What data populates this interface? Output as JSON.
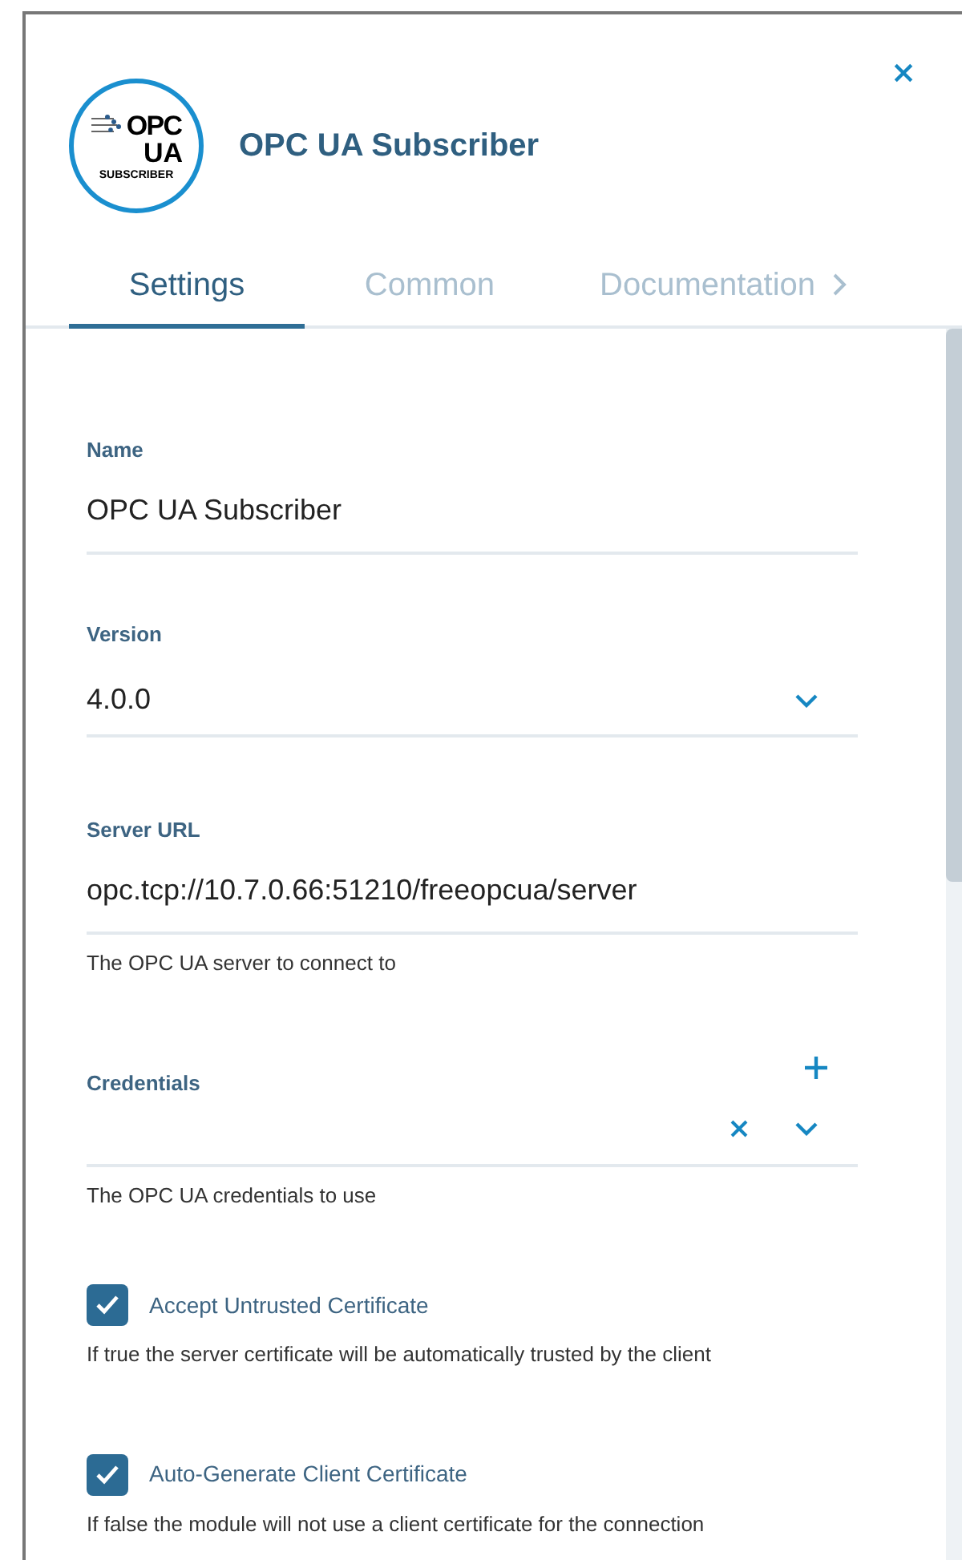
{
  "header": {
    "logo": {
      "line1": "OPC",
      "line2": "UA",
      "line3": "SUBSCRIBER"
    },
    "title": "OPC UA Subscriber"
  },
  "tabs": [
    {
      "label": "Settings",
      "selected": true
    },
    {
      "label": "Common",
      "selected": false
    },
    {
      "label": "Documentation",
      "selected": false
    }
  ],
  "fields": [
    {
      "kind": "text",
      "label": "Name",
      "value": "OPC UA Subscriber"
    },
    {
      "kind": "select",
      "label": "Version",
      "value": "4.0.0"
    },
    {
      "kind": "text",
      "label": "Server URL",
      "value": "opc.tcp://10.7.0.66:51210/freeopcua/server",
      "help": "The OPC UA server to connect to"
    },
    {
      "kind": "multiselect",
      "label": "Credentials",
      "help": "The OPC UA credentials to use"
    },
    {
      "kind": "checkbox",
      "label": "Accept Untrusted Certificate",
      "checked": true,
      "help": "If true the server certificate will be automatically trusted by the client"
    },
    {
      "kind": "checkbox",
      "label": "Auto-Generate Client Certificate",
      "checked": true,
      "help": "If false the module will not use a client certificate for the connection"
    }
  ]
}
